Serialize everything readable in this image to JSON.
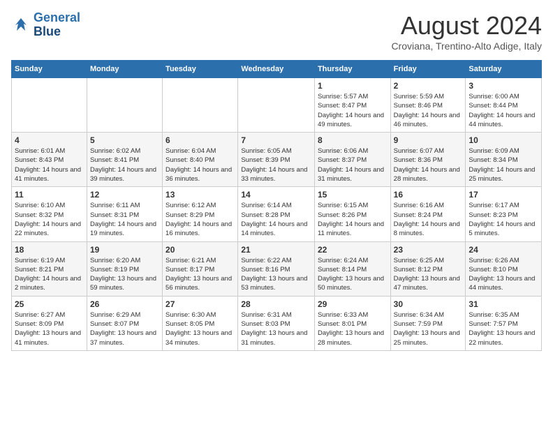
{
  "logo": {
    "line1": "General",
    "line2": "Blue"
  },
  "title": "August 2024",
  "subtitle": "Croviana, Trentino-Alto Adige, Italy",
  "weekdays": [
    "Sunday",
    "Monday",
    "Tuesday",
    "Wednesday",
    "Thursday",
    "Friday",
    "Saturday"
  ],
  "weeks": [
    [
      {
        "day": "",
        "info": ""
      },
      {
        "day": "",
        "info": ""
      },
      {
        "day": "",
        "info": ""
      },
      {
        "day": "",
        "info": ""
      },
      {
        "day": "1",
        "info": "Sunrise: 5:57 AM\nSunset: 8:47 PM\nDaylight: 14 hours and 49 minutes."
      },
      {
        "day": "2",
        "info": "Sunrise: 5:59 AM\nSunset: 8:46 PM\nDaylight: 14 hours and 46 minutes."
      },
      {
        "day": "3",
        "info": "Sunrise: 6:00 AM\nSunset: 8:44 PM\nDaylight: 14 hours and 44 minutes."
      }
    ],
    [
      {
        "day": "4",
        "info": "Sunrise: 6:01 AM\nSunset: 8:43 PM\nDaylight: 14 hours and 41 minutes."
      },
      {
        "day": "5",
        "info": "Sunrise: 6:02 AM\nSunset: 8:41 PM\nDaylight: 14 hours and 39 minutes."
      },
      {
        "day": "6",
        "info": "Sunrise: 6:04 AM\nSunset: 8:40 PM\nDaylight: 14 hours and 36 minutes."
      },
      {
        "day": "7",
        "info": "Sunrise: 6:05 AM\nSunset: 8:39 PM\nDaylight: 14 hours and 33 minutes."
      },
      {
        "day": "8",
        "info": "Sunrise: 6:06 AM\nSunset: 8:37 PM\nDaylight: 14 hours and 31 minutes."
      },
      {
        "day": "9",
        "info": "Sunrise: 6:07 AM\nSunset: 8:36 PM\nDaylight: 14 hours and 28 minutes."
      },
      {
        "day": "10",
        "info": "Sunrise: 6:09 AM\nSunset: 8:34 PM\nDaylight: 14 hours and 25 minutes."
      }
    ],
    [
      {
        "day": "11",
        "info": "Sunrise: 6:10 AM\nSunset: 8:32 PM\nDaylight: 14 hours and 22 minutes."
      },
      {
        "day": "12",
        "info": "Sunrise: 6:11 AM\nSunset: 8:31 PM\nDaylight: 14 hours and 19 minutes."
      },
      {
        "day": "13",
        "info": "Sunrise: 6:12 AM\nSunset: 8:29 PM\nDaylight: 14 hours and 16 minutes."
      },
      {
        "day": "14",
        "info": "Sunrise: 6:14 AM\nSunset: 8:28 PM\nDaylight: 14 hours and 14 minutes."
      },
      {
        "day": "15",
        "info": "Sunrise: 6:15 AM\nSunset: 8:26 PM\nDaylight: 14 hours and 11 minutes."
      },
      {
        "day": "16",
        "info": "Sunrise: 6:16 AM\nSunset: 8:24 PM\nDaylight: 14 hours and 8 minutes."
      },
      {
        "day": "17",
        "info": "Sunrise: 6:17 AM\nSunset: 8:23 PM\nDaylight: 14 hours and 5 minutes."
      }
    ],
    [
      {
        "day": "18",
        "info": "Sunrise: 6:19 AM\nSunset: 8:21 PM\nDaylight: 14 hours and 2 minutes."
      },
      {
        "day": "19",
        "info": "Sunrise: 6:20 AM\nSunset: 8:19 PM\nDaylight: 13 hours and 59 minutes."
      },
      {
        "day": "20",
        "info": "Sunrise: 6:21 AM\nSunset: 8:17 PM\nDaylight: 13 hours and 56 minutes."
      },
      {
        "day": "21",
        "info": "Sunrise: 6:22 AM\nSunset: 8:16 PM\nDaylight: 13 hours and 53 minutes."
      },
      {
        "day": "22",
        "info": "Sunrise: 6:24 AM\nSunset: 8:14 PM\nDaylight: 13 hours and 50 minutes."
      },
      {
        "day": "23",
        "info": "Sunrise: 6:25 AM\nSunset: 8:12 PM\nDaylight: 13 hours and 47 minutes."
      },
      {
        "day": "24",
        "info": "Sunrise: 6:26 AM\nSunset: 8:10 PM\nDaylight: 13 hours and 44 minutes."
      }
    ],
    [
      {
        "day": "25",
        "info": "Sunrise: 6:27 AM\nSunset: 8:09 PM\nDaylight: 13 hours and 41 minutes."
      },
      {
        "day": "26",
        "info": "Sunrise: 6:29 AM\nSunset: 8:07 PM\nDaylight: 13 hours and 37 minutes."
      },
      {
        "day": "27",
        "info": "Sunrise: 6:30 AM\nSunset: 8:05 PM\nDaylight: 13 hours and 34 minutes."
      },
      {
        "day": "28",
        "info": "Sunrise: 6:31 AM\nSunset: 8:03 PM\nDaylight: 13 hours and 31 minutes."
      },
      {
        "day": "29",
        "info": "Sunrise: 6:33 AM\nSunset: 8:01 PM\nDaylight: 13 hours and 28 minutes."
      },
      {
        "day": "30",
        "info": "Sunrise: 6:34 AM\nSunset: 7:59 PM\nDaylight: 13 hours and 25 minutes."
      },
      {
        "day": "31",
        "info": "Sunrise: 6:35 AM\nSunset: 7:57 PM\nDaylight: 13 hours and 22 minutes."
      }
    ]
  ]
}
